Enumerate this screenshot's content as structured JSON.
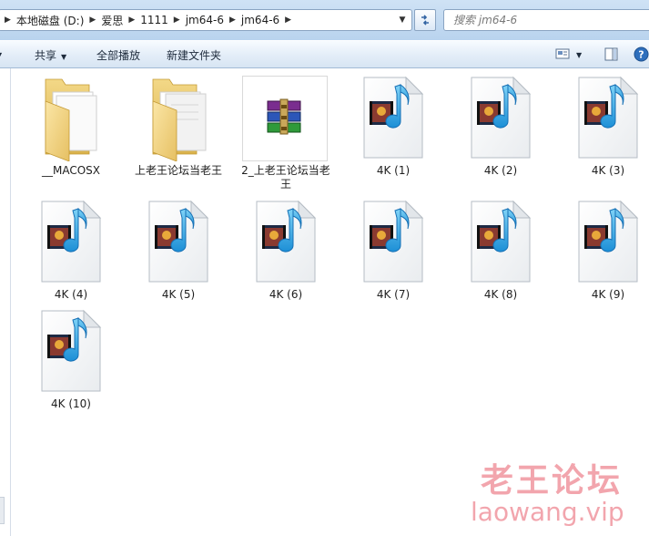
{
  "address_bar": {
    "crumbs": [
      "本地磁盘 (D:)",
      "爱思",
      "1111",
      "jm64-6",
      "jm64-6"
    ]
  },
  "search": {
    "placeholder": "搜索 jm64-6"
  },
  "toolbar": {
    "share_label": "共享",
    "play_all_label": "全部播放",
    "new_folder_label": "新建文件夹"
  },
  "files": [
    {
      "label": "__MACOSX",
      "icon": "folder-icon"
    },
    {
      "label": "上老王论坛当老王",
      "icon": "folder-icon"
    },
    {
      "label": "2_上老王论坛当老王",
      "icon": "winrar-archive-icon"
    },
    {
      "label": "4K (1)",
      "icon": "video-file-icon"
    },
    {
      "label": "4K (2)",
      "icon": "video-file-icon"
    },
    {
      "label": "4K (3)",
      "icon": "video-file-icon"
    },
    {
      "label": "4K (4)",
      "icon": "video-file-icon"
    },
    {
      "label": "4K (5)",
      "icon": "video-file-icon"
    },
    {
      "label": "4K (6)",
      "icon": "video-file-icon"
    },
    {
      "label": "4K (7)",
      "icon": "video-file-icon"
    },
    {
      "label": "4K (8)",
      "icon": "video-file-icon"
    },
    {
      "label": "4K (9)",
      "icon": "video-file-icon"
    },
    {
      "label": "4K (10)",
      "icon": "video-file-icon"
    }
  ],
  "watermark": {
    "title": "老王论坛",
    "url": "laowang.vip"
  }
}
